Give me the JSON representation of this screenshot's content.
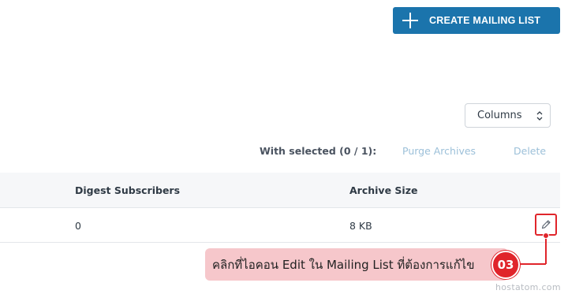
{
  "header": {
    "create_button_label": "CREATE MAILING LIST"
  },
  "toolbar": {
    "columns_label": "Columns",
    "with_selected": "With selected (0 / 1):",
    "purge_label": "Purge Archives",
    "delete_label": "Delete"
  },
  "table": {
    "columns": [
      "Digest Subscribers",
      "Archive Size"
    ],
    "rows": [
      {
        "digest_subscribers": "0",
        "archive_size": "8 KB"
      }
    ]
  },
  "annotation": {
    "step": "03",
    "text": "คลิกที่ไอคอน Edit ใน Mailing List ที่ต้องการแก้ไข",
    "color": "#e0252b"
  },
  "watermark": "hostatom.com",
  "icons": {
    "create": "plus-icon",
    "columns_caret": "sort-caret-icon",
    "edit": "pencil-icon"
  },
  "colors": {
    "primary": "#1b74ac",
    "link_disabled": "#9cc0d9",
    "highlight": "#e0252b",
    "callout_bg": "#f6c7cb"
  }
}
